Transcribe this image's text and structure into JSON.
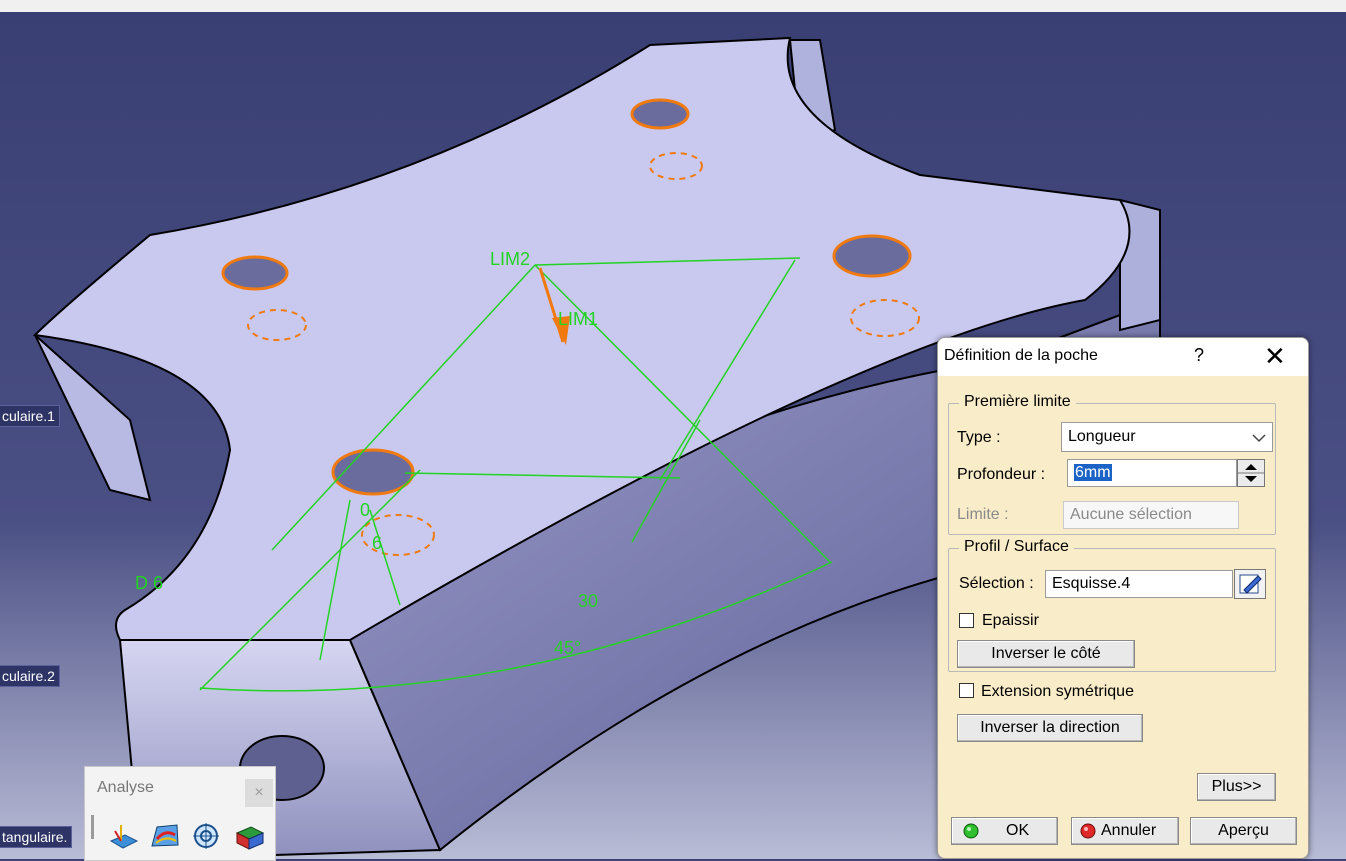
{
  "viewer": {
    "tree_labels": [
      "culaire.1",
      "culaire.2",
      "tangulaire."
    ],
    "annotations": {
      "lim2": "LIM2",
      "lim1": "LIM1",
      "diameter": "D 6",
      "dim_30": "30",
      "angle_45": "45°",
      "depth_6": "6",
      "depth_0": "0"
    }
  },
  "analyse_toolbar": {
    "title": "Analyse",
    "close": "×",
    "tools": [
      "draft-analysis-icon",
      "curvature-analysis-icon",
      "measure-icon",
      "thickness-analysis-icon"
    ]
  },
  "dialog": {
    "title": "Définition de la poche",
    "help": "?",
    "close": "✕",
    "first_limit": {
      "legend": "Première limite",
      "type_label": "Type :",
      "type_value": "Longueur",
      "depth_label": "Profondeur :",
      "depth_value": "6mm",
      "limit_label": "Limite :",
      "limit_value": "Aucune sélection"
    },
    "profile": {
      "legend": "Profil / Surface",
      "selection_label": "Sélection :",
      "selection_value": "Esquisse.4",
      "thicken_label": "Epaissir",
      "invert_side": "Inverser le côté"
    },
    "symmetric_label": "Extension symétrique",
    "invert_direction": "Inverser la direction",
    "more": "Plus>>",
    "ok": "OK",
    "cancel": "Annuler",
    "preview": "Aperçu"
  },
  "colors": {
    "viewport_bg": "#3e4377",
    "part_face": "#c9c9f0",
    "annotation_green": "#22d322",
    "hole_orange": "#f07a10",
    "dialog_bg": "#f9ecc9"
  }
}
